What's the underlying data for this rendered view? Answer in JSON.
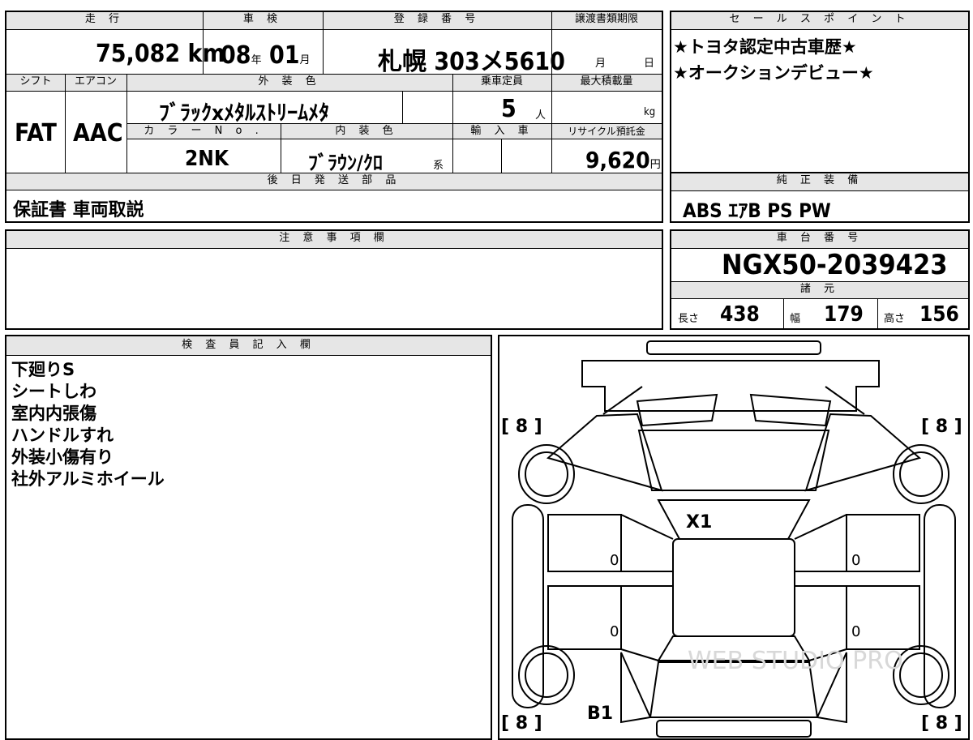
{
  "vehicle": {
    "mileage_label": "走 行",
    "mileage_value": "75,082",
    "mileage_unit": "km",
    "shaken_label": "車 検",
    "shaken_year": "08",
    "year_unit": "年",
    "shaken_month": "01",
    "month_unit": "月",
    "reg_label": "登 録 番 号",
    "reg_value": "札幌 303メ5610",
    "transfer_label": "譲渡書類期限",
    "transfer_month_unit": "月",
    "transfer_day_unit": "日",
    "shift_label": "シフト",
    "shift_value": "FAT",
    "ac_label": "エアコン",
    "ac_value": "AAC",
    "exterior_label": "外 装 色",
    "exterior_value": "ﾌﾞﾗｯｸxﾒﾀﾙｽﾄﾘｰﾑﾒﾀ",
    "capacity_label": "乗車定員",
    "capacity_value": "5",
    "capacity_unit": "人",
    "maxload_label": "最大積載量",
    "maxload_unit": "kg",
    "color_no_label": "カ ラ ー N o .",
    "color_no_value": "2NK",
    "interior_label": "内 装 色",
    "interior_value": "ﾌﾞﾗｳﾝ/ｸﾛ",
    "interior_suffix": "系",
    "import_label": "輸 入 車",
    "recycle_label": "リサイクル預託金",
    "recycle_value": "9,620",
    "recycle_unit": "円",
    "later_label": "後 日 発 送 部 品",
    "later_value": "保証書 車両取説"
  },
  "sales": {
    "label": "セ ー ル ス ポ イ ン ト",
    "lines": [
      "★トヨタ認定中古車歴★",
      "★オークションデビュー★"
    ]
  },
  "equipment": {
    "label": "純 正 装 備",
    "value": "ABS ｴｱB PS PW"
  },
  "notes": {
    "label": "注 意 事 項 欄"
  },
  "chassis": {
    "label": "車 台 番 号",
    "value": "NGX50-2039423",
    "spec_label": "諸 元",
    "length_label": "長さ",
    "length_value": "438",
    "width_label": "幅",
    "width_value": "179",
    "height_label": "高さ",
    "height_value": "156"
  },
  "inspector": {
    "label": "検 査 員 記 入 欄",
    "lines": [
      "下廻りS",
      "シートしわ",
      "室内内張傷",
      "ハンドルすれ",
      "外装小傷有り",
      "社外アルミホイール"
    ]
  },
  "diagram": {
    "tire_fl": "[ 8 ]",
    "tire_fr": "[ 8 ]",
    "tire_rl": "[ 8 ]",
    "tire_rr": "[ 8 ]",
    "mark_windshield": "X1",
    "mark_rear": "B1",
    "door_lf": "0",
    "door_lr": "0",
    "door_rf": "0",
    "door_rr": "0",
    "watermark": "WEB STUDIO PRO"
  }
}
